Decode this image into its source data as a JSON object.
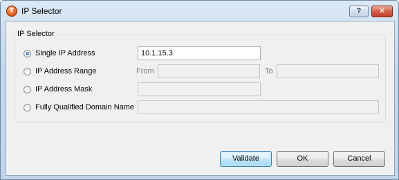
{
  "window": {
    "title": "IP Selector",
    "icon": "tenable-app-icon",
    "help_glyph": "?",
    "close_glyph": "✕"
  },
  "group": {
    "label": "IP Selector"
  },
  "options": {
    "single": {
      "label": "Single IP Address",
      "value": "10.1.15.3",
      "selected": true
    },
    "range": {
      "label": "IP Address Range",
      "from_label": "From",
      "to_label": "To",
      "from_value": "",
      "to_value": "",
      "selected": false
    },
    "mask": {
      "label": "IP Address Mask",
      "value": "",
      "selected": false
    },
    "fqdn": {
      "label": "Fully Qualified Domain Name",
      "value": "",
      "selected": false
    }
  },
  "buttons": {
    "validate": "Validate",
    "ok": "OK",
    "cancel": "Cancel"
  },
  "colors": {
    "close_button": "#c5402a",
    "default_button_border": "#3c7fb1"
  }
}
